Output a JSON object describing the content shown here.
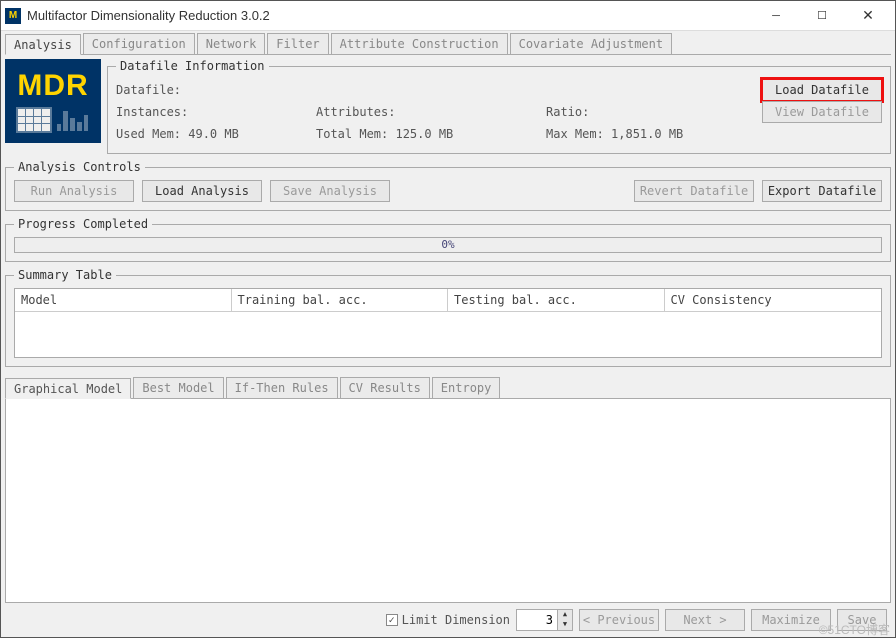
{
  "window": {
    "title": "Multifactor Dimensionality Reduction 3.0.2",
    "icon_label": "MDR"
  },
  "main_tabs": [
    "Analysis",
    "Configuration",
    "Network",
    "Filter",
    "Attribute Construction",
    "Covariate Adjustment"
  ],
  "main_tab_active": 0,
  "logo": {
    "text": "MDR"
  },
  "datafile_info": {
    "legend": "Datafile Information",
    "rows": [
      {
        "label": "Datafile:",
        "c2": "",
        "c3": ""
      },
      {
        "label": "Instances:",
        "c2": "Attributes:",
        "c3": "Ratio:"
      },
      {
        "label": "Used Mem: 49.0 MB",
        "c2": "Total Mem: 125.0 MB",
        "c3": "Max Mem: 1,851.0 MB"
      }
    ],
    "load_btn": "Load Datafile",
    "view_btn": "View Datafile"
  },
  "analysis_controls": {
    "legend": "Analysis Controls",
    "run": "Run Analysis",
    "load": "Load Analysis",
    "save": "Save Analysis",
    "revert": "Revert Datafile",
    "export": "Export Datafile"
  },
  "progress": {
    "legend": "Progress Completed",
    "text": "0%"
  },
  "summary": {
    "legend": "Summary Table",
    "headers": [
      "Model",
      "Training bal. acc.",
      "Testing bal. acc.",
      "CV Consistency"
    ]
  },
  "sub_tabs": [
    "Graphical Model",
    "Best Model",
    "If-Then Rules",
    "CV Results",
    "Entropy"
  ],
  "sub_tab_active": 0,
  "bottom": {
    "limit_label": "Limit Dimension",
    "limit_value": "3",
    "prev": "< Previous",
    "next": "Next >",
    "maximize": "Maximize",
    "save": "Save"
  },
  "watermark": "©51CTO博客"
}
